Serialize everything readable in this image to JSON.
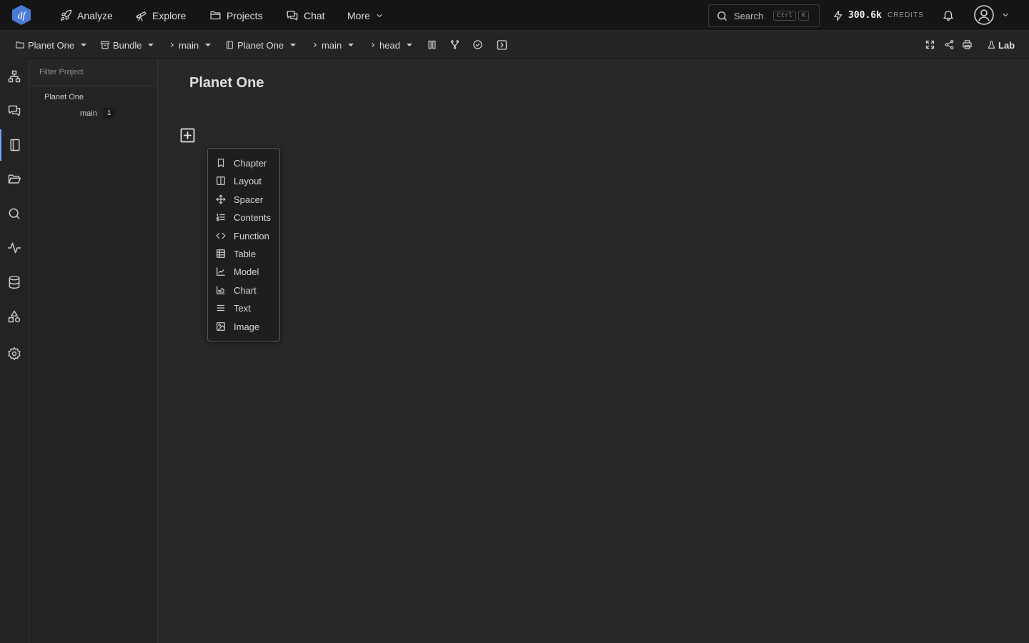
{
  "topnav": {
    "logo_text": "df",
    "analyze": "Analyze",
    "explore": "Explore",
    "projects": "Projects",
    "chat": "Chat",
    "more": "More",
    "search": {
      "label": "Search",
      "key1": "Ctrl",
      "key2": "K"
    },
    "credits": {
      "value": "300.6k",
      "label": "CREDITS"
    }
  },
  "toolbar": {
    "project": "Planet One",
    "bundle": "Bundle",
    "branch": "main",
    "notebook": "Planet One",
    "branch2": "main",
    "ref": "head",
    "lab": "Lab"
  },
  "sidebar": {
    "filter_placeholder": "Filter Project",
    "project": "Planet One",
    "branch": {
      "label": "main",
      "count": "1"
    }
  },
  "main": {
    "title": "Planet One"
  },
  "menu": {
    "items": [
      "Chapter",
      "Layout",
      "Spacer",
      "Contents",
      "Function",
      "Table",
      "Model",
      "Chart",
      "Text",
      "Image"
    ]
  },
  "colors": {
    "accent": "#6ea8ff",
    "logo": "#4a7bd6",
    "background": "#282828",
    "topbar": "#151515"
  }
}
